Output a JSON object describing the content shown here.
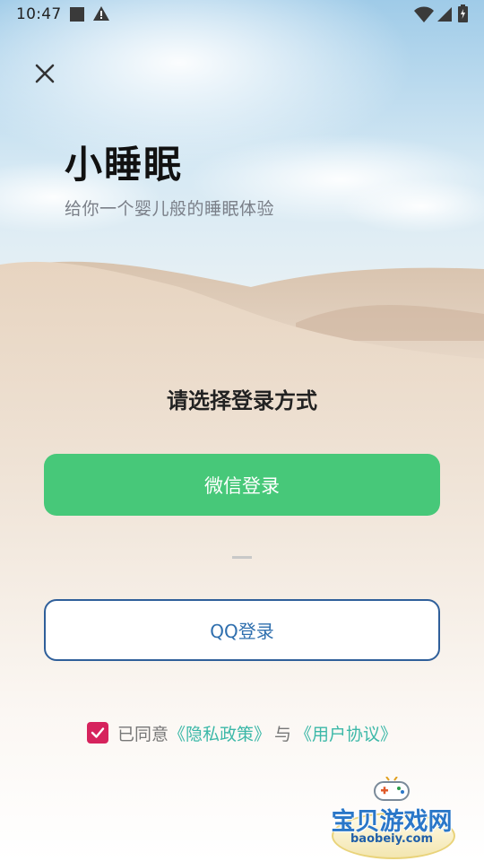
{
  "status_bar": {
    "time": "10:47"
  },
  "header": {
    "app_title": "小睡眠",
    "app_subtitle": "给你一个婴儿般的睡眠体验"
  },
  "login": {
    "prompt": "请选择登录方式",
    "wechat_label": "微信登录",
    "qq_label": "QQ登录"
  },
  "agreement": {
    "checked": true,
    "prefix": "已同意",
    "privacy_link": "《隐私政策》",
    "conjunction": "与",
    "user_agreement_link": "《用户协议》"
  },
  "watermark": {
    "brand": "宝贝游戏网",
    "url": "baobeiy.com"
  },
  "colors": {
    "wechat_green": "#47c879",
    "qq_border": "#2f5f9a",
    "link_teal": "#3cb8a8",
    "checkbox_pink": "#d6235d"
  },
  "icons": {
    "close": "close-icon",
    "checkbox": "checkmark-icon"
  }
}
